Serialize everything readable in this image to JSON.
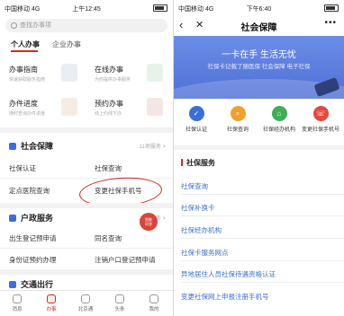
{
  "left": {
    "status": {
      "carrier": "中国移动  4G",
      "time": "上午12:45"
    },
    "search_placeholder": "查找办事项",
    "segments": {
      "personal": "个人办事",
      "corporate": "企业办事"
    },
    "cards": [
      {
        "title": "办事指南",
        "sub": "快速获取服务指南"
      },
      {
        "title": "在线办事",
        "sub": "为你提供办事服务"
      },
      {
        "title": "办件进度",
        "sub": "随时查询办件进度"
      },
      {
        "title": "预约办事",
        "sub": "线上约线下办"
      }
    ],
    "social": {
      "title": "社会保障",
      "more": "11项服务 >",
      "items": [
        "社保认证",
        "社保查询",
        "定点医院查询",
        "变更社保手机号"
      ]
    },
    "household": {
      "title": "户政服务",
      "more": "29项服务 >",
      "items": [
        "出生登记预申请",
        "同名查询",
        "身份证预约办理",
        "注销户口登记预申请"
      ]
    },
    "transport": {
      "title": "交通出行"
    },
    "robot": {
      "line1": "智能",
      "line2": "问答"
    },
    "tabs": [
      "消息",
      "办事",
      "北京通",
      "头条",
      "我的"
    ]
  },
  "right": {
    "status": {
      "carrier": "中国移动  4G",
      "time": "下午6:40"
    },
    "nav": {
      "back": "‹",
      "close": "✕",
      "title": "社会保障",
      "more": "•••"
    },
    "banner": {
      "title": "一卡在手 生活无忧",
      "subtitle": "社保卡记载了随医保 社会保障 电子社保"
    },
    "quick": [
      {
        "label": "社保认证",
        "color": "#3b6fd8"
      },
      {
        "label": "社保查询",
        "color": "#f0a02a"
      },
      {
        "label": "社保经办机构",
        "color": "#3fae55"
      },
      {
        "label": "变更社保手机号",
        "color": "#e5483a"
      }
    ],
    "section_title": "社保服务",
    "links": [
      "社保查询",
      "社保补换卡",
      "社保经办机构",
      "社保卡服务网点",
      "异地居住人员社保待遇资格认证",
      "变更社保网上申报注册手机号"
    ]
  }
}
